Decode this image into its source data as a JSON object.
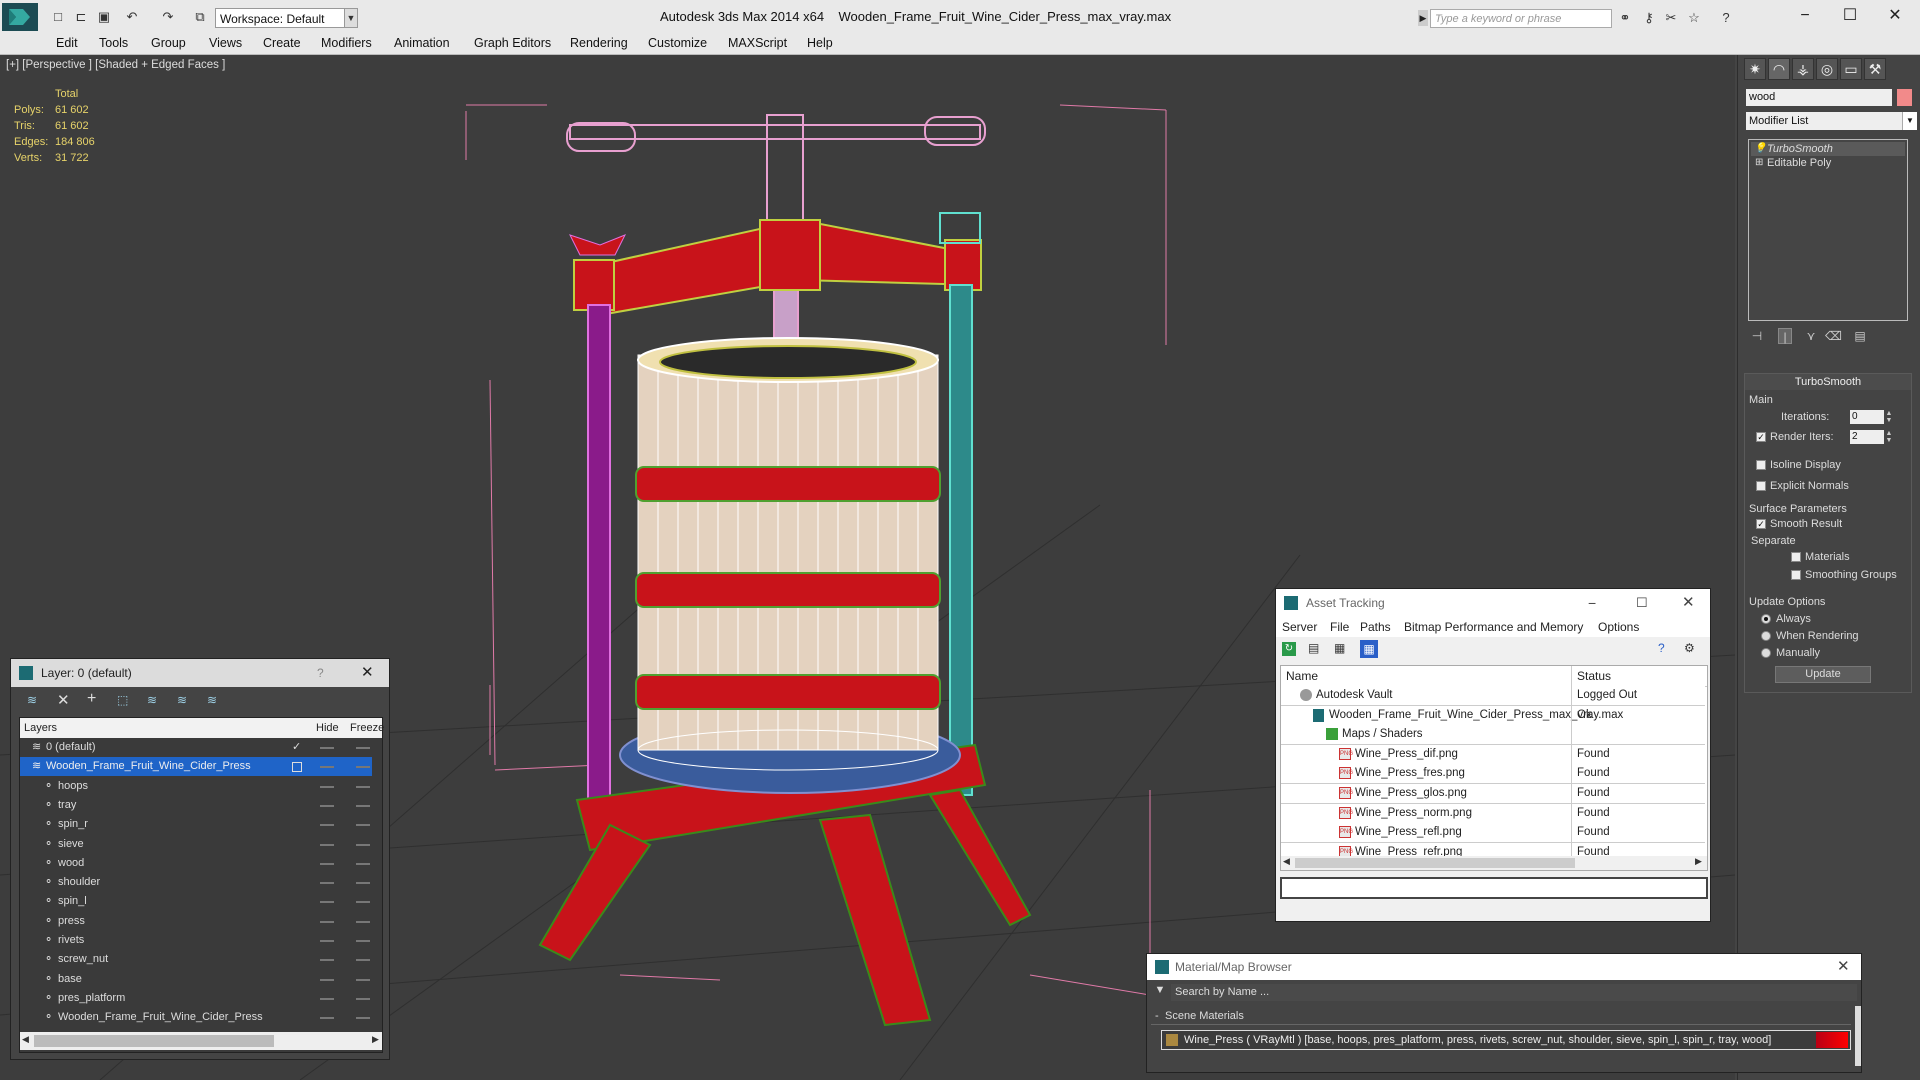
{
  "app": {
    "title": "Autodesk 3ds Max  2014 x64",
    "file": "Wooden_Frame_Fruit_Wine_Cider_Press_max_vray.max",
    "workspace": "Workspace: Default",
    "search_placeholder": "Type a keyword or phrase"
  },
  "menu": [
    "Edit",
    "Tools",
    "Group",
    "Views",
    "Create",
    "Modifiers",
    "Animation",
    "Graph Editors",
    "Rendering",
    "Customize",
    "MAXScript",
    "Help"
  ],
  "viewport": {
    "label": "[+] [Perspective ] [Shaded + Edged Faces ]",
    "stats": {
      "header": "Total",
      "rows": [
        {
          "k": "Polys:",
          "v": "61 602"
        },
        {
          "k": "Tris:",
          "v": "61 602"
        },
        {
          "k": "Edges:",
          "v": "184 806"
        },
        {
          "k": "Verts:",
          "v": "31 722"
        }
      ]
    }
  },
  "command_panel": {
    "object_name": "wood",
    "modifier_list": "Modifier List",
    "stack": [
      "TurboSmooth",
      "Editable Poly"
    ],
    "turbosmooth": {
      "title": "TurboSmooth",
      "main": "Main",
      "iterations_label": "Iterations:",
      "iterations": "0",
      "render_iters_label": "Render Iters:",
      "render_iters": "2",
      "isoline": "Isoline Display",
      "explicit": "Explicit Normals",
      "surface": "Surface Parameters",
      "smooth_result": "Smooth Result",
      "separate": "Separate",
      "materials": "Materials",
      "smoothing_groups": "Smoothing Groups",
      "update_options": "Update Options",
      "always": "Always",
      "when_rendering": "When Rendering",
      "manually": "Manually",
      "update": "Update"
    }
  },
  "layers": {
    "title": "Layer: 0 (default)",
    "help": "?",
    "col_layers": "Layers",
    "col_hide": "Hide",
    "col_freeze": "Freeze",
    "rows": [
      {
        "name": "0 (default)",
        "indent": 0
      },
      {
        "name": "Wooden_Frame_Fruit_Wine_Cider_Press",
        "indent": 0
      },
      {
        "name": "hoops",
        "indent": 1
      },
      {
        "name": "tray",
        "indent": 1
      },
      {
        "name": "spin_r",
        "indent": 1
      },
      {
        "name": "sieve",
        "indent": 1
      },
      {
        "name": "wood",
        "indent": 1
      },
      {
        "name": "shoulder",
        "indent": 1
      },
      {
        "name": "spin_l",
        "indent": 1
      },
      {
        "name": "press",
        "indent": 1
      },
      {
        "name": "rivets",
        "indent": 1
      },
      {
        "name": "screw_nut",
        "indent": 1
      },
      {
        "name": "base",
        "indent": 1
      },
      {
        "name": "pres_platform",
        "indent": 1
      },
      {
        "name": "Wooden_Frame_Fruit_Wine_Cider_Press",
        "indent": 1
      }
    ]
  },
  "asset_tracking": {
    "title": "Asset Tracking",
    "menu": [
      "Server",
      "File",
      "Paths",
      "Bitmap Performance and Memory",
      "Options"
    ],
    "col_name": "Name",
    "col_status": "Status",
    "rows": [
      {
        "name": "Autodesk Vault",
        "status": "Logged Out",
        "indent": 1
      },
      {
        "name": "Wooden_Frame_Fruit_Wine_Cider_Press_max_vray.max",
        "status": "Ok",
        "indent": 2
      },
      {
        "name": "Maps / Shaders",
        "status": "",
        "indent": 3
      },
      {
        "name": "Wine_Press_dif.png",
        "status": "Found",
        "indent": 4
      },
      {
        "name": "Wine_Press_fres.png",
        "status": "Found",
        "indent": 4
      },
      {
        "name": "Wine_Press_glos.png",
        "status": "Found",
        "indent": 4
      },
      {
        "name": "Wine_Press_norm.png",
        "status": "Found",
        "indent": 4
      },
      {
        "name": "Wine_Press_refl.png",
        "status": "Found",
        "indent": 4
      },
      {
        "name": "Wine_Press_refr.png",
        "status": "Found",
        "indent": 4
      }
    ]
  },
  "material_browser": {
    "title": "Material/Map Browser",
    "search": "Search by Name ...",
    "section": "Scene Materials",
    "material": "Wine_Press  ( VRayMtl ) [base, hoops, pres_platform, press, rivets, screw_nut, shoulder, sieve, spin_l, spin_r, tray, wood]"
  },
  "colors": {
    "accent": "#1f64c8",
    "press_red": "#c8131a",
    "stat_yellow": "#e7d36a"
  }
}
